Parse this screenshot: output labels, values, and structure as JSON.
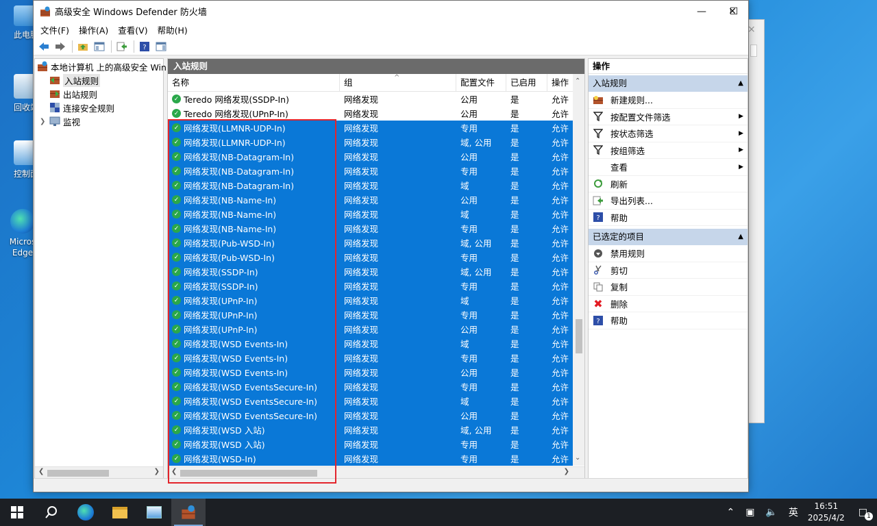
{
  "desktop": {
    "icons": [
      {
        "label": "此电脑"
      },
      {
        "label": "回收站"
      },
      {
        "label": "控制面"
      },
      {
        "label": "Micros Edge"
      }
    ]
  },
  "window": {
    "title": "高级安全 Windows Defender 防火墙",
    "menu": [
      "文件(F)",
      "操作(A)",
      "查看(V)",
      "帮助(H)"
    ]
  },
  "tree": {
    "root": "本地计算机 上的高级安全 Win",
    "items": [
      "入站规则",
      "出站规则",
      "连接安全规则",
      "监视"
    ]
  },
  "center": {
    "title": "入站规则",
    "columns": [
      "名称",
      "组",
      "配置文件",
      "已启用",
      "操作"
    ],
    "rows": [
      {
        "name": "Teredo 网络发现(SSDP-In)",
        "group": "网络发现",
        "profile": "公用",
        "enabled": "是",
        "action": "允许",
        "selected": false
      },
      {
        "name": "Teredo 网络发现(UPnP-In)",
        "group": "网络发现",
        "profile": "公用",
        "enabled": "是",
        "action": "允许",
        "selected": false
      },
      {
        "name": "网络发现(LLMNR-UDP-In)",
        "group": "网络发现",
        "profile": "专用",
        "enabled": "是",
        "action": "允许",
        "selected": true
      },
      {
        "name": "网络发现(LLMNR-UDP-In)",
        "group": "网络发现",
        "profile": "域, 公用",
        "enabled": "是",
        "action": "允许",
        "selected": true
      },
      {
        "name": "网络发现(NB-Datagram-In)",
        "group": "网络发现",
        "profile": "公用",
        "enabled": "是",
        "action": "允许",
        "selected": true
      },
      {
        "name": "网络发现(NB-Datagram-In)",
        "group": "网络发现",
        "profile": "专用",
        "enabled": "是",
        "action": "允许",
        "selected": true
      },
      {
        "name": "网络发现(NB-Datagram-In)",
        "group": "网络发现",
        "profile": "域",
        "enabled": "是",
        "action": "允许",
        "selected": true
      },
      {
        "name": "网络发现(NB-Name-In)",
        "group": "网络发现",
        "profile": "公用",
        "enabled": "是",
        "action": "允许",
        "selected": true
      },
      {
        "name": "网络发现(NB-Name-In)",
        "group": "网络发现",
        "profile": "域",
        "enabled": "是",
        "action": "允许",
        "selected": true
      },
      {
        "name": "网络发现(NB-Name-In)",
        "group": "网络发现",
        "profile": "专用",
        "enabled": "是",
        "action": "允许",
        "selected": true
      },
      {
        "name": "网络发现(Pub-WSD-In)",
        "group": "网络发现",
        "profile": "域, 公用",
        "enabled": "是",
        "action": "允许",
        "selected": true
      },
      {
        "name": "网络发现(Pub-WSD-In)",
        "group": "网络发现",
        "profile": "专用",
        "enabled": "是",
        "action": "允许",
        "selected": true
      },
      {
        "name": "网络发现(SSDP-In)",
        "group": "网络发现",
        "profile": "域, 公用",
        "enabled": "是",
        "action": "允许",
        "selected": true
      },
      {
        "name": "网络发现(SSDP-In)",
        "group": "网络发现",
        "profile": "专用",
        "enabled": "是",
        "action": "允许",
        "selected": true
      },
      {
        "name": "网络发现(UPnP-In)",
        "group": "网络发现",
        "profile": "域",
        "enabled": "是",
        "action": "允许",
        "selected": true
      },
      {
        "name": "网络发现(UPnP-In)",
        "group": "网络发现",
        "profile": "专用",
        "enabled": "是",
        "action": "允许",
        "selected": true
      },
      {
        "name": "网络发现(UPnP-In)",
        "group": "网络发现",
        "profile": "公用",
        "enabled": "是",
        "action": "允许",
        "selected": true
      },
      {
        "name": "网络发现(WSD Events-In)",
        "group": "网络发现",
        "profile": "域",
        "enabled": "是",
        "action": "允许",
        "selected": true
      },
      {
        "name": "网络发现(WSD Events-In)",
        "group": "网络发现",
        "profile": "专用",
        "enabled": "是",
        "action": "允许",
        "selected": true
      },
      {
        "name": "网络发现(WSD Events-In)",
        "group": "网络发现",
        "profile": "公用",
        "enabled": "是",
        "action": "允许",
        "selected": true
      },
      {
        "name": "网络发现(WSD EventsSecure-In)",
        "group": "网络发现",
        "profile": "专用",
        "enabled": "是",
        "action": "允许",
        "selected": true
      },
      {
        "name": "网络发现(WSD EventsSecure-In)",
        "group": "网络发现",
        "profile": "域",
        "enabled": "是",
        "action": "允许",
        "selected": true
      },
      {
        "name": "网络发现(WSD EventsSecure-In)",
        "group": "网络发现",
        "profile": "公用",
        "enabled": "是",
        "action": "允许",
        "selected": true
      },
      {
        "name": "网络发现(WSD 入站)",
        "group": "网络发现",
        "profile": "域, 公用",
        "enabled": "是",
        "action": "允许",
        "selected": true
      },
      {
        "name": "网络发现(WSD 入站)",
        "group": "网络发现",
        "profile": "专用",
        "enabled": "是",
        "action": "允许",
        "selected": true
      },
      {
        "name": "网络发现(WSD-In)",
        "group": "网络发现",
        "profile": "专用",
        "enabled": "是",
        "action": "允许",
        "selected": true
      }
    ]
  },
  "actions": {
    "title": "操作",
    "section1": "入站规则",
    "items1": [
      {
        "label": "新建规则...",
        "icon": "new-rule-icon",
        "sub": false
      },
      {
        "label": "按配置文件筛选",
        "icon": "filter-icon",
        "sub": true
      },
      {
        "label": "按状态筛选",
        "icon": "filter-icon",
        "sub": true
      },
      {
        "label": "按组筛选",
        "icon": "filter-icon",
        "sub": true
      },
      {
        "label": "查看",
        "icon": "",
        "sub": true
      },
      {
        "label": "刷新",
        "icon": "refresh-icon",
        "sub": false
      },
      {
        "label": "导出列表...",
        "icon": "export-icon",
        "sub": false
      },
      {
        "label": "帮助",
        "icon": "help-icon",
        "sub": false
      }
    ],
    "section2": "已选定的项目",
    "items2": [
      {
        "label": "禁用规则",
        "icon": "disable-icon"
      },
      {
        "label": "剪切",
        "icon": "cut-icon"
      },
      {
        "label": "复制",
        "icon": "copy-icon"
      },
      {
        "label": "删除",
        "icon": "delete-icon"
      },
      {
        "label": "帮助",
        "icon": "help-icon"
      }
    ]
  },
  "taskbar": {
    "ime": "英",
    "time": "16:51",
    "date": "2025/4/2",
    "notification_count": "1"
  },
  "colors": {
    "selection": "#0a78d7",
    "highlight_box": "#e3242b",
    "section_header": "#c6d6ea"
  }
}
